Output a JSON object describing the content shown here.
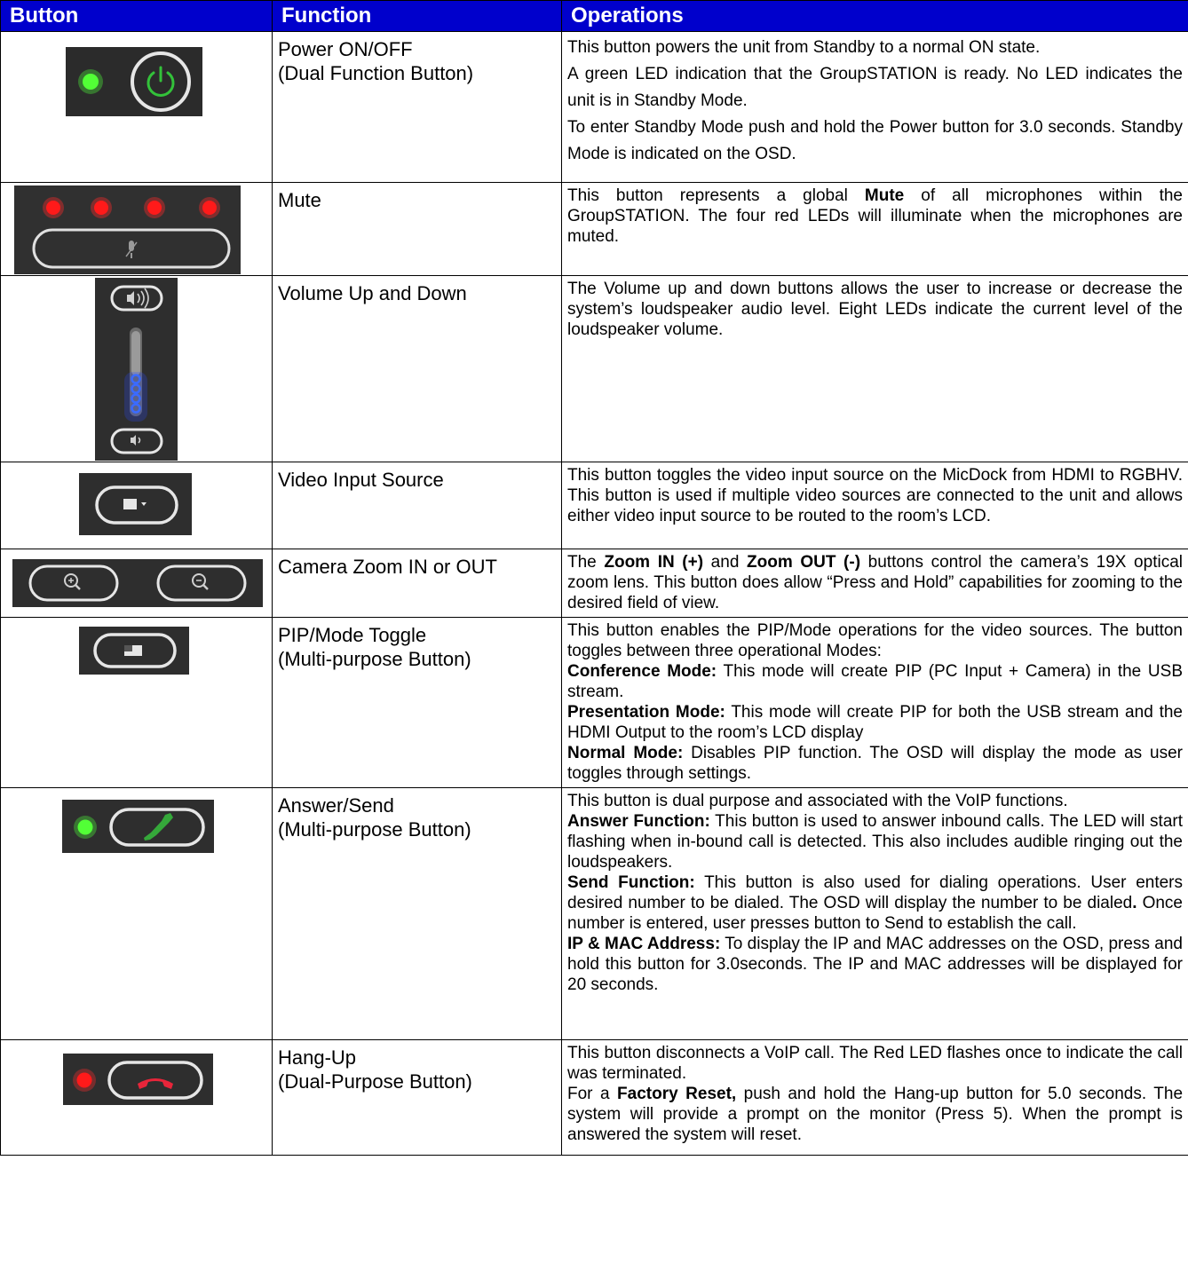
{
  "headers": {
    "button": "Button",
    "function": "Function",
    "operations": "Operations"
  },
  "rows": [
    {
      "function": [
        "Power ON/OFF",
        "(Dual Function Button)"
      ],
      "icon": "power-button-with-green-led",
      "ops": [
        [
          {
            "t": "This button powers the unit from Standby to a normal ON state."
          }
        ],
        [
          {
            "t": "A green LED indication that the GroupSTATION is ready. No LED indicates the unit is in Standby Mode."
          }
        ],
        [
          {
            "t": "To enter Standby Mode push and hold the Power button for 3.0 seconds.  Standby Mode is indicated on the OSD."
          }
        ]
      ]
    },
    {
      "function": [
        "Mute"
      ],
      "icon": "mute-button-with-four-red-leds",
      "ops": [
        [
          {
            "t": "This button represents a global "
          },
          {
            "b": "Mute"
          },
          {
            "t": " of all microphones within the GroupSTATION.  The four red LEDs will illuminate when the microphones are muted."
          }
        ]
      ]
    },
    {
      "function": [
        "Volume Up and Down"
      ],
      "icon": "volume-buttons-with-blue-leds",
      "ops": [
        [
          {
            "t": "The Volume up and down buttons allows the user to increase or decrease the system’s loudspeaker audio level. Eight LEDs indicate the current level of the loudspeaker volume."
          }
        ]
      ]
    },
    {
      "function": [
        "Video Input Source"
      ],
      "icon": "video-input-button",
      "ops": [
        [
          {
            "t": "This button toggles the video input source on the MicDock from HDMI to RGBHV. This button is used if multiple video sources are connected to the unit and allows either video input source to be routed to the room’s LCD."
          }
        ]
      ]
    },
    {
      "function": [
        "Camera Zoom IN or OUT"
      ],
      "icon": "zoom-in-and-zoom-out-buttons",
      "ops": [
        [
          {
            "t": "The "
          },
          {
            "b": "Zoom IN (+)"
          },
          {
            "t": " and "
          },
          {
            "b": "Zoom OUT (-)"
          },
          {
            "t": " buttons control the camera’s 19X optical zoom lens.  This button does allow “Press and Hold” capabilities for zooming to the desired field of view."
          }
        ]
      ]
    },
    {
      "function": [
        "PIP/Mode Toggle",
        "(Multi-purpose Button)"
      ],
      "icon": "pip-mode-button",
      "ops": [
        [
          {
            "t": "This button enables the PIP/Mode operations for the video sources.  The button toggles between three operational Modes:"
          }
        ],
        [
          {
            "b": "Conference Mode:"
          },
          {
            "t": " This mode will create PIP (PC Input + Camera) in the USB stream."
          }
        ],
        [
          {
            "b": "Presentation Mode:"
          },
          {
            "t": " This mode will create PIP for both the USB stream and the HDMI Output to the room’s LCD display"
          }
        ],
        [
          {
            "b": "Normal Mode:"
          },
          {
            "t": " Disables PIP function.  The OSD will display the mode as user toggles through settings."
          }
        ]
      ]
    },
    {
      "function": [
        "Answer/Send",
        "(Multi-purpose Button)"
      ],
      "icon": "answer-button-with-green-led",
      "ops": [
        [
          {
            "t": "This button is dual purpose and associated with the VoIP functions."
          }
        ],
        [
          {
            "b": "Answer Function:"
          },
          {
            "t": " This button is used to answer inbound calls.  The LED will start flashing when in-bound call is detected.  This also includes audible ringing out the loudspeakers."
          }
        ],
        [
          {
            "b": "Send Function:"
          },
          {
            "t": " This button is also used for dialing operations.  User enters desired number to be dialed.  The OSD will display the number to be dialed"
          },
          {
            "b": "."
          },
          {
            "t": "  Once number is entered, user presses button to Send to establish the call."
          }
        ],
        [
          {
            "b": "IP & MAC Address:"
          },
          {
            "t": "  To display the IP and MAC addresses on the OSD, press and hold this button for 3.0seconds.  The IP and MAC addresses will be displayed for 20 seconds."
          }
        ]
      ]
    },
    {
      "function": [
        "Hang-Up",
        "(Dual-Purpose Button)"
      ],
      "icon": "hang-up-button-with-red-led",
      "ops": [
        [
          {
            "t": "This button disconnects a VoIP call.  The Red LED flashes once to indicate the call was terminated."
          }
        ],
        [
          {
            "t": "For a "
          },
          {
            "b": "Factory Reset,"
          },
          {
            "t": " push and hold the Hang-up button for 5.0 seconds.  The system will provide a prompt on the monitor (Press 5).  When the prompt is answered the system will reset."
          }
        ]
      ]
    }
  ]
}
